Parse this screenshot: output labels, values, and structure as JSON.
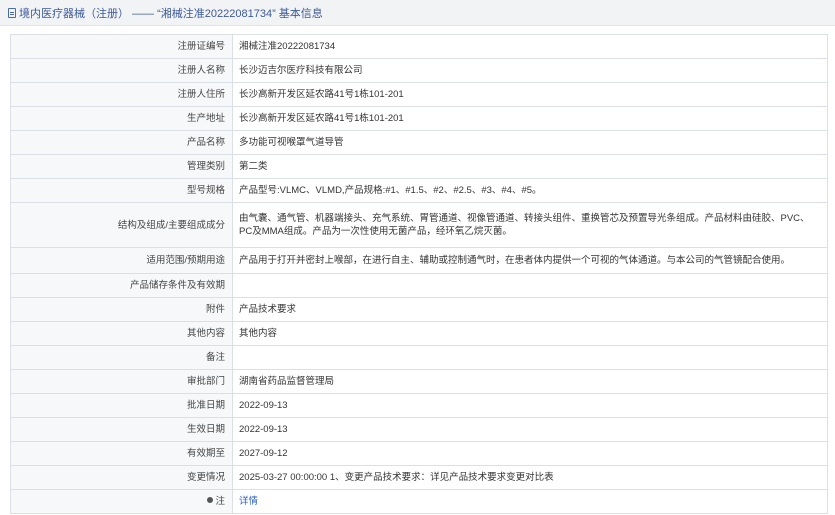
{
  "breadcrumb": {
    "text": "境内医疗器械（注册） —— “湘械注准20222081734” 基本信息"
  },
  "rows": [
    {
      "label": "注册证编号",
      "value": "湘械注准20222081734"
    },
    {
      "label": "注册人名称",
      "value": "长沙迈吉尔医疗科技有限公司"
    },
    {
      "label": "注册人住所",
      "value": "长沙高新开发区延农路41号1栋101-201"
    },
    {
      "label": "生产地址",
      "value": "长沙高新开发区延农路41号1栋101-201"
    },
    {
      "label": "产品名称",
      "value": "多功能可视喉罩气道导管"
    },
    {
      "label": "管理类别",
      "value": "第二类"
    },
    {
      "label": "型号规格",
      "value": "产品型号:VLMC、VLMD,产品规格:#1、#1.5、#2、#2.5、#3、#4、#5。"
    },
    {
      "label": "结构及组成/主要组成成分",
      "value": "由气囊、通气管、机器端接头、充气系统、胃管通道、视像管通道、转接头组件、重换管芯及预置导光条组成。产品材料由硅胶、PVC、PC及MMA组成。产品为一次性使用无菌产品，经环氧乙烷灭菌。"
    },
    {
      "label": "适用范围/预期用途",
      "value": "产品用于打开并密封上喉部，在进行自主、辅助或控制通气时，在患者体内提供一个可视的气体通道。与本公司的气管镜配合使用。"
    },
    {
      "label": "产品储存条件及有效期",
      "value": ""
    },
    {
      "label": "附件",
      "value": "产品技术要求"
    },
    {
      "label": "其他内容",
      "value": "其他内容"
    },
    {
      "label": "备注",
      "value": ""
    },
    {
      "label": "审批部门",
      "value": "湖南省药品监督管理局"
    },
    {
      "label": "批准日期",
      "value": "2022-09-13"
    },
    {
      "label": "生效日期",
      "value": "2022-09-13"
    },
    {
      "label": "有效期至",
      "value": "2027-09-12"
    },
    {
      "label": "变更情况",
      "value": "2025-03-27 00:00:00 1、变更产品技术要求：详见产品技术要求变更对比表"
    }
  ],
  "footer_row": {
    "label": "注",
    "link": "详情",
    "icon": "pin-icon"
  }
}
